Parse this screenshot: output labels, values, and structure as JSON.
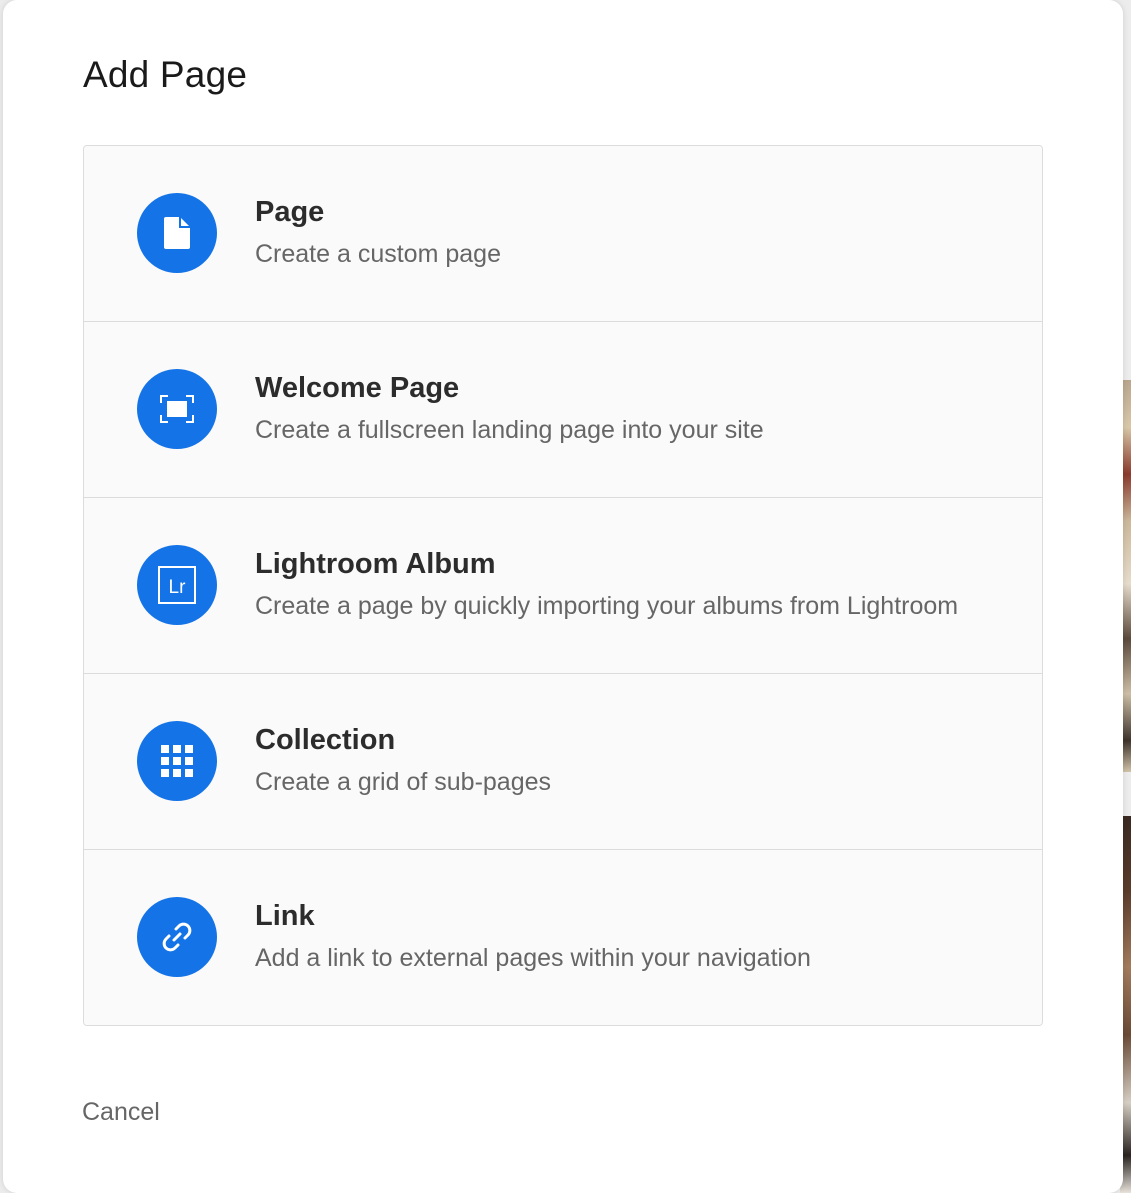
{
  "dialog": {
    "title": "Add Page",
    "cancel_label": "Cancel"
  },
  "options": [
    {
      "title": "Page",
      "description": "Create a custom page",
      "icon": "page-icon"
    },
    {
      "title": "Welcome Page",
      "description": "Create a fullscreen landing page into your site",
      "icon": "fullscreen-icon"
    },
    {
      "title": "Lightroom Album",
      "description": "Create a page by quickly importing your albums from Lightroom",
      "icon": "lightroom-icon",
      "icon_text": "Lr"
    },
    {
      "title": "Collection",
      "description": "Create a grid of sub-pages",
      "icon": "grid-icon"
    },
    {
      "title": "Link",
      "description": "Add a link to external pages within your navigation",
      "icon": "link-icon"
    }
  ],
  "colors": {
    "accent": "#1473e6",
    "title_text": "#1a1a1a",
    "secondary_text": "#666666",
    "border": "#dcdcdc"
  }
}
